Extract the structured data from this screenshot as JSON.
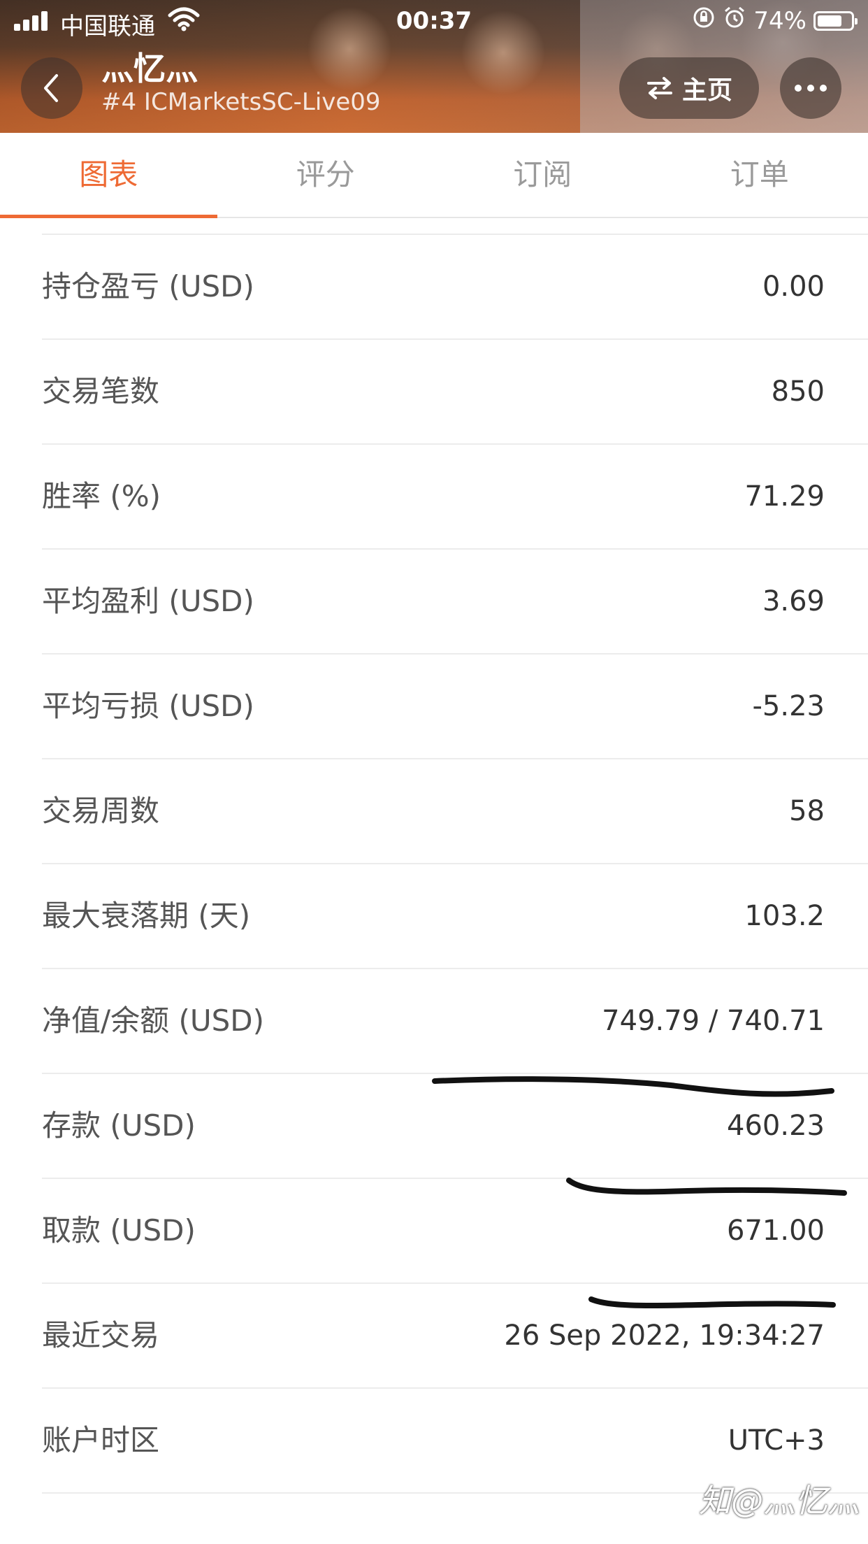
{
  "status_bar": {
    "carrier": "中国联通",
    "time": "00:37",
    "battery_percent": "74%",
    "battery_level": 0.74,
    "icons": [
      "signal-icon",
      "wifi-icon",
      "rotation-lock-icon",
      "alarm-icon",
      "battery-icon"
    ]
  },
  "header": {
    "title": "灬忆灬",
    "subtitle": "#4 ICMarketsSC-Live09",
    "home_label": "主页",
    "icons": [
      "back-icon",
      "swap-icon",
      "more-icon"
    ]
  },
  "tabs": [
    {
      "label": "图表",
      "active": true
    },
    {
      "label": "评分",
      "active": false
    },
    {
      "label": "订阅",
      "active": false
    },
    {
      "label": "订单",
      "active": false
    }
  ],
  "stats": [
    {
      "label": "持仓盈亏 (USD)",
      "value": "0.00"
    },
    {
      "label": "交易笔数",
      "value": "850"
    },
    {
      "label": "胜率 (%)",
      "value": "71.29"
    },
    {
      "label": "平均盈利 (USD)",
      "value": "3.69"
    },
    {
      "label": "平均亏损 (USD)",
      "value": "-5.23"
    },
    {
      "label": "交易周数",
      "value": "58"
    },
    {
      "label": "最大衰落期 (天)",
      "value": "103.2"
    },
    {
      "label": "净值/余额 (USD)",
      "value": "749.79 / 740.71"
    },
    {
      "label": "存款 (USD)",
      "value": "460.23"
    },
    {
      "label": "取款 (USD)",
      "value": "671.00"
    },
    {
      "label": "最近交易",
      "value": "26 Sep 2022, 19:34:27"
    },
    {
      "label": "账户时区",
      "value": "UTC+3"
    }
  ],
  "watermark": "知@灬忆灬",
  "colors": {
    "accent": "#ee6a34",
    "label": "#555555",
    "value": "#333333"
  }
}
